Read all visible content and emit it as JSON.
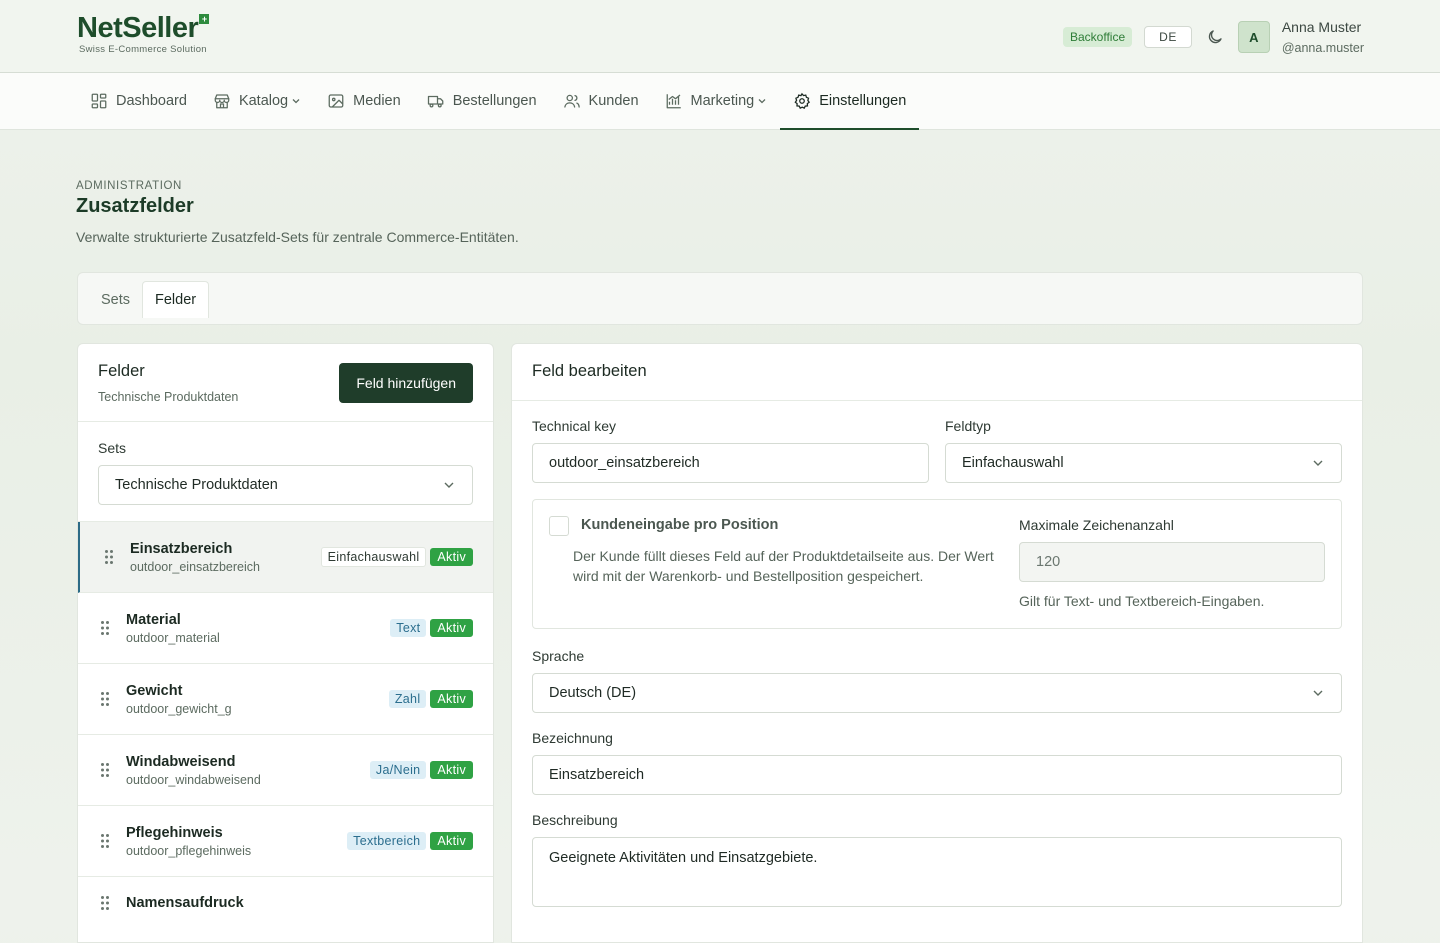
{
  "brand": {
    "name": "NetSeller",
    "tagline": "Swiss E-Commerce Solution"
  },
  "header": {
    "badge": "Backoffice",
    "language": "DE",
    "user": {
      "initial": "A",
      "name": "Anna Muster",
      "handle": "@anna.muster"
    }
  },
  "nav": {
    "items": [
      {
        "label": "Dashboard"
      },
      {
        "label": "Katalog"
      },
      {
        "label": "Medien"
      },
      {
        "label": "Bestellungen"
      },
      {
        "label": "Kunden"
      },
      {
        "label": "Marketing"
      },
      {
        "label": "Einstellungen"
      }
    ]
  },
  "page": {
    "eyebrow": "ADMINISTRATION",
    "title": "Zusatzfelder",
    "description": "Verwalte strukturierte Zusatzfeld-Sets für zentrale Commerce-Entitäten."
  },
  "tabs": [
    {
      "label": "Sets"
    },
    {
      "label": "Felder"
    }
  ],
  "fields_panel": {
    "title": "Felder",
    "subtitle": "Technische Produktdaten",
    "add_button": "Feld hinzufügen",
    "sets_label": "Sets",
    "sets_value": "Technische Produktdaten",
    "items": [
      {
        "name": "Einsatzbereich",
        "key": "outdoor_einsatzbereich",
        "type": "Einfachauswahl",
        "status": "Aktiv"
      },
      {
        "name": "Material",
        "key": "outdoor_material",
        "type": "Text",
        "status": "Aktiv"
      },
      {
        "name": "Gewicht",
        "key": "outdoor_gewicht_g",
        "type": "Zahl",
        "status": "Aktiv"
      },
      {
        "name": "Windabweisend",
        "key": "outdoor_windabweisend",
        "type": "Ja/Nein",
        "status": "Aktiv"
      },
      {
        "name": "Pflegehinweis",
        "key": "outdoor_pflegehinweis",
        "type": "Textbereich",
        "status": "Aktiv"
      },
      {
        "name": "Namensaufdruck",
        "key": "",
        "type": "",
        "status": ""
      }
    ]
  },
  "editor": {
    "title": "Feld bearbeiten",
    "technical_key_label": "Technical key",
    "technical_key_value": "outdoor_einsatzbereich",
    "field_type_label": "Feldtyp",
    "field_type_value": "Einfachauswahl",
    "customer_input_title": "Kundeneingabe pro Position",
    "customer_input_desc": "Der Kunde füllt dieses Feld auf der Produktdetailseite aus. Der Wert wird mit der Warenkorb- und Bestellposition gespeichert.",
    "max_chars_label": "Maximale Zeichenanzahl",
    "max_chars_value": "120",
    "max_chars_hint": "Gilt für Text- und Textbereich-Eingaben.",
    "language_label": "Sprache",
    "language_value": "Deutsch (DE)",
    "name_label": "Bezeichnung",
    "name_value": "Einsatzbereich",
    "description_label": "Beschreibung",
    "description_value": "Geeignete Aktivitäten und Einsatzgebiete."
  }
}
